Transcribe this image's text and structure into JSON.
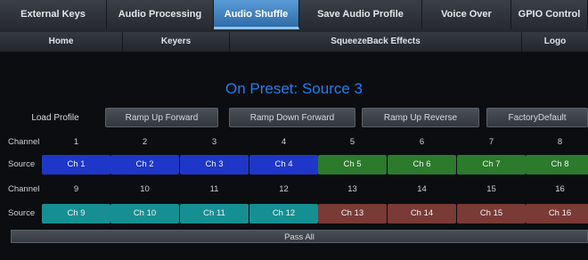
{
  "top_tabs": [
    {
      "label": "External Keys"
    },
    {
      "label": "Audio Processing"
    },
    {
      "label": "Audio Shuffle",
      "active": true
    },
    {
      "label": "Save Audio Profile"
    },
    {
      "label": "Voice Over"
    },
    {
      "label": "GPIO Control"
    }
  ],
  "sub_tabs": [
    {
      "label": "Home"
    },
    {
      "label": "Keyers"
    },
    {
      "label": "SqueezeBack Effects"
    },
    {
      "label": "Logo"
    }
  ],
  "preset_text": "On Preset: Source 3",
  "load_profile_label": "Load Profile",
  "profile_buttons": [
    "Ramp Up Forward",
    "Ramp Down Forward",
    "Ramp Up Reverse",
    "FactoryDefault"
  ],
  "channel_label": "Channel",
  "source_label": "Source",
  "rows": [
    {
      "channels": [
        "1",
        "2",
        "3",
        "4",
        "5",
        "6",
        "7",
        "8"
      ],
      "sources": [
        {
          "label": "Ch 1",
          "color": "#1e37c9"
        },
        {
          "label": "Ch 2",
          "color": "#1e37c9"
        },
        {
          "label": "Ch 3",
          "color": "#1e37c9"
        },
        {
          "label": "Ch 4",
          "color": "#1e37c9"
        },
        {
          "label": "Ch 5",
          "color": "#2c7a2c"
        },
        {
          "label": "Ch 6",
          "color": "#2c7a2c"
        },
        {
          "label": "Ch 7",
          "color": "#2c7a2c"
        },
        {
          "label": "Ch 8",
          "color": "#2c7a2c"
        }
      ]
    },
    {
      "channels": [
        "9",
        "10",
        "11",
        "12",
        "13",
        "14",
        "15",
        "16"
      ],
      "sources": [
        {
          "label": "Ch 9",
          "color": "#168f92"
        },
        {
          "label": "Ch 10",
          "color": "#168f92"
        },
        {
          "label": "Ch 11",
          "color": "#168f92"
        },
        {
          "label": "Ch 12",
          "color": "#168f92"
        },
        {
          "label": "Ch 13",
          "color": "#7a3a36"
        },
        {
          "label": "Ch 14",
          "color": "#7a3a36"
        },
        {
          "label": "Ch 15",
          "color": "#7a3a36"
        },
        {
          "label": "Ch 16",
          "color": "#7a3a36"
        }
      ]
    }
  ],
  "pass_all_label": "Pass All",
  "colors": {
    "accent": "#1e7ff0",
    "active_tab": "#4b8fd0"
  }
}
